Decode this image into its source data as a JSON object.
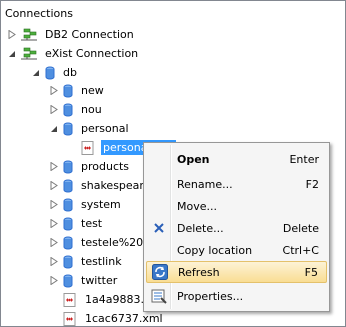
{
  "panel": {
    "title": "Connections"
  },
  "tree": {
    "connections": [
      {
        "label": "DB2 Connection"
      },
      {
        "label": "eXist Connection"
      }
    ],
    "db": {
      "label": "db"
    },
    "collections": [
      {
        "label": "new"
      },
      {
        "label": "nou"
      },
      {
        "label": "personal"
      },
      {
        "label": "products"
      },
      {
        "label": "shakespeare"
      },
      {
        "label": "system"
      },
      {
        "label": "test"
      },
      {
        "label": "testele%20m"
      },
      {
        "label": "testlink"
      },
      {
        "label": "twitter"
      }
    ],
    "selected_file": {
      "label": "personal.xml"
    },
    "files": [
      {
        "label": "1a4a9883.xml"
      },
      {
        "label": "1cac6737.xml"
      }
    ]
  },
  "context_menu": {
    "items": [
      {
        "label": "Open",
        "shortcut": "Enter"
      },
      {
        "label": "Rename...",
        "shortcut": "F2"
      },
      {
        "label": "Move...",
        "shortcut": ""
      },
      {
        "label": "Delete...",
        "shortcut": "Delete"
      },
      {
        "label": "Copy location",
        "shortcut": "Ctrl+C"
      },
      {
        "label": "Refresh",
        "shortcut": "F5"
      },
      {
        "label": "Properties...",
        "shortcut": ""
      }
    ]
  },
  "colors": {
    "selection": "#3399ff",
    "menu_hover": "#f9dd93",
    "db_icon": "#2f6fd0",
    "xml_icon": "#cc2222"
  }
}
